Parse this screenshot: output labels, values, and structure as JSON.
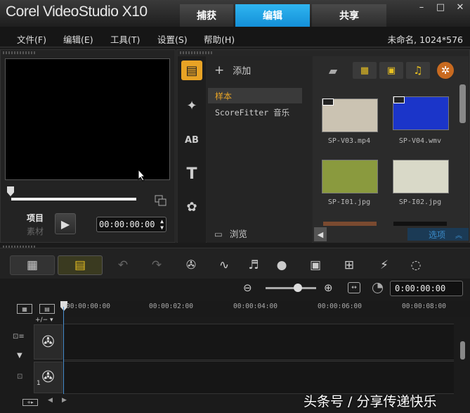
{
  "app": {
    "title": "Corel VideoStudio X10",
    "tabs": [
      {
        "label": "捕获"
      },
      {
        "label": "编辑"
      },
      {
        "label": "共享"
      }
    ],
    "window_controls": [
      "–",
      "□",
      "✕"
    ]
  },
  "menu": {
    "items": [
      "文件(F)",
      "编辑(E)",
      "工具(T)",
      "设置(S)",
      "帮助(H)"
    ],
    "project_info": "未命名, 1024*576"
  },
  "player": {
    "project_label": "项目",
    "clip_label": "素材",
    "timecode": "00:00:00:00",
    "progress": 0
  },
  "library": {
    "add_label": "添加",
    "folders": [
      "样本",
      "ScoreFitter 音乐"
    ],
    "browse_label": "浏览",
    "options_label": "选项",
    "thumbnails": [
      {
        "name": "SP-V03.mp4",
        "color": "#cbc3b2"
      },
      {
        "name": "SP-V04.wmv",
        "color": "#1b35c9"
      },
      {
        "name": "SP-I01.jpg",
        "color": "#8a9a3e"
      },
      {
        "name": "SP-I02.jpg",
        "color": "#d9d9c8"
      }
    ]
  },
  "timeline": {
    "timecode": "0:00:00:00",
    "ruler_ticks": [
      "00:00:00:00",
      "00:00:02:00",
      "00:00:04:00",
      "00:00:06:00",
      "00:00:08:00"
    ],
    "track_number": "1",
    "zoom_level": 0.6
  },
  "watermark": "头条号 / 分享传递快乐",
  "colors": {
    "accent": "#1a9de0",
    "selected_folder": "#e8a325",
    "options_text": "#3a8ac8"
  }
}
